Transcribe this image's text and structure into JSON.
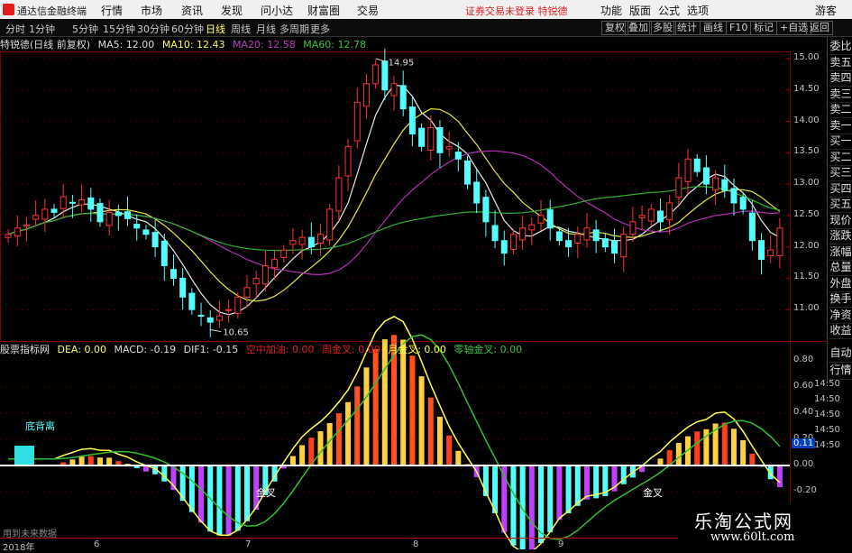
{
  "app": {
    "title": "通达信金融终端",
    "notice": "证券交易未登录 特锐德",
    "guest": "游客"
  },
  "menu": [
    "行情",
    "市场",
    "资讯",
    "发现",
    "问小达",
    "财富圈",
    "交易"
  ],
  "menu_right": [
    "功能",
    "版面",
    "公式",
    "选项"
  ],
  "periods": [
    "分时",
    "1分钟",
    "5分钟",
    "15分钟",
    "30分钟",
    "60分钟",
    "日线",
    "周线",
    "月线",
    "多周期",
    "更多"
  ],
  "active_period": "日线",
  "toolbar_right": [
    "复权",
    "叠加",
    "多股",
    "统计",
    "画线",
    "F10",
    "标记",
    "+自选",
    "返回"
  ],
  "main_header": {
    "stock": "特锐德(日线 前复权)",
    "ma5": "MA5: 12.00",
    "ma10": "MA10: 12.43",
    "ma20": "MA20: 12.58",
    "ma60": "MA60: 12.78"
  },
  "sub_header": {
    "name": "股票指标网",
    "dea": "DEA: 0.00",
    "macd": "MACD: -0.19",
    "dif": "DIF1: -0.15",
    "kz": "空中加油: 0.00",
    "zj": "周金叉: 0.00",
    "yj": "月金叉: 0.00",
    "lz": "零轴金叉: 0.00"
  },
  "right_panel": [
    "委比",
    "卖五",
    "卖四",
    "卖三",
    "卖二",
    "卖一",
    "买一",
    "买二",
    "买三",
    "买四",
    "买五",
    "现价",
    "涨跌",
    "涨幅",
    "总量",
    "外盘",
    "换手",
    "净资",
    "收益"
  ],
  "right_panel2": [
    "自动",
    "行情"
  ],
  "price_axis": [
    "15.00",
    "14.50",
    "14.00",
    "13.50",
    "13.00",
    "12.50",
    "12.00",
    "11.50",
    "11.00"
  ],
  "sub_axis": [
    "0.80",
    "0.60",
    "0.40",
    "0.20",
    "0.00",
    "-0.20"
  ],
  "sub_axis_partial": [
    "14:50",
    "14:50",
    "14:50",
    "14:50",
    "14:50"
  ],
  "sub_value_badge": "0.11",
  "annotations": {
    "high": "14.95",
    "low": "10.65",
    "divergence": "底背离",
    "gold1": "金叉",
    "gold2": "金叉"
  },
  "dates": [
    "2018年",
    "6",
    "7",
    "8",
    "9"
  ],
  "hint": "用到未来数据",
  "watermark": {
    "cn": "乐淘公式网",
    "url": "www.60lt.com"
  },
  "chart_data": {
    "type": "candlestick",
    "price_ylim": [
      10.5,
      15.1
    ],
    "closes": [
      12.2,
      12.3,
      12.35,
      12.5,
      12.6,
      12.55,
      12.8,
      12.7,
      12.75,
      12.6,
      12.4,
      12.55,
      12.5,
      12.45,
      12.3,
      12.2,
      12.0,
      11.7,
      11.5,
      11.2,
      11.0,
      10.9,
      10.8,
      10.9,
      11.0,
      11.2,
      11.35,
      11.5,
      11.7,
      11.8,
      11.95,
      12.1,
      12.15,
      12.0,
      12.2,
      12.6,
      13.1,
      13.6,
      14.3,
      14.6,
      14.9,
      14.5,
      14.6,
      14.2,
      13.8,
      13.6,
      13.9,
      13.5,
      13.6,
      13.4,
      13.0,
      12.7,
      12.4,
      12.1,
      11.9,
      12.2,
      12.3,
      12.35,
      12.5,
      12.3,
      12.1,
      12.0,
      12.2,
      12.3,
      12.1,
      12.0,
      11.9,
      12.2,
      12.4,
      12.5,
      12.6,
      12.4,
      12.7,
      13.1,
      13.4,
      13.2,
      13.0,
      13.1,
      12.9,
      12.7,
      12.6,
      12.1,
      11.8,
      11.95,
      12.3
    ]
  }
}
